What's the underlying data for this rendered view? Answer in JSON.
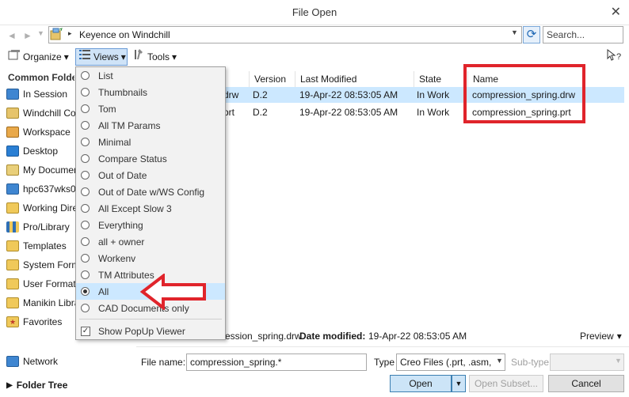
{
  "window": {
    "title": "File Open",
    "close_glyph": "✕"
  },
  "nav": {
    "back_glyph": "◄",
    "forward_glyph": "►"
  },
  "address": {
    "path": "Keyence on Windchill",
    "chevron": "▸",
    "dropdown_glyph": "▼",
    "refresh_glyph": "⟳",
    "search_placeholder": "Search..."
  },
  "toolbar": {
    "organize": "Organize",
    "views": "Views",
    "tools": "Tools",
    "caret": "▾",
    "help_glyph": "?"
  },
  "sidebar": {
    "header": "Common Folders",
    "items": [
      {
        "label": "In Session",
        "icon": "monitor-icon"
      },
      {
        "label": "Windchill Content",
        "icon": "windchill-icon"
      },
      {
        "label": "Workspace",
        "icon": "workspace-icon"
      },
      {
        "label": "Desktop",
        "icon": "desktop-icon"
      },
      {
        "label": "My Documents",
        "icon": "documents-icon"
      },
      {
        "label": "hpc637wks0",
        "icon": "computer-icon"
      },
      {
        "label": "Working Directory",
        "icon": "folder-icon"
      },
      {
        "label": "Pro/Library",
        "icon": "library-icon"
      },
      {
        "label": "Templates",
        "icon": "folder-icon"
      },
      {
        "label": "System Formats",
        "icon": "folder-icon"
      },
      {
        "label": "User Formats",
        "icon": "folder-icon"
      },
      {
        "label": "Manikin Library",
        "icon": "folder-icon"
      },
      {
        "label": "Favorites",
        "icon": "star-folder-icon"
      }
    ],
    "network": "Network",
    "folder_tree": "Folder Tree"
  },
  "table": {
    "headers": {
      "version": "Version",
      "last_modified": "Last Modified",
      "state": "State",
      "name": "Name"
    },
    "rows": [
      {
        "ext_frag": "drw",
        "version": "D.2",
        "last_modified": "19-Apr-22 08:53:05 AM",
        "state": "In Work",
        "name": "compression_spring.drw"
      },
      {
        "ext_frag": "prt",
        "version": "D.2",
        "last_modified": "19-Apr-22 08:53:05 AM",
        "state": "In Work",
        "name": "compression_spring.prt"
      }
    ]
  },
  "preview": {
    "file_frag": "ression_spring.drw",
    "modified_label": "Date modified:",
    "modified_value": "19-Apr-22 08:53:05 AM",
    "toggle": "Preview",
    "caret": "▾"
  },
  "bottom": {
    "file_name_label": "File name:",
    "file_name_value": "compression_spring.*",
    "type_label": "Type",
    "type_value": "Creo Files (.prt, .asm,",
    "subtype_label": "Sub-type",
    "open": "Open",
    "open_subset": "Open Subset...",
    "cancel": "Cancel"
  },
  "views_menu": {
    "items": [
      "List",
      "Thumbnails",
      "Tom",
      "All TM Params",
      "Minimal",
      "Compare Status",
      "Out of Date",
      "Out of Date w/WS Config",
      "All Except Slow 3",
      "Everything",
      "all + owner",
      "Workenv",
      "TM Attributes",
      "All",
      "CAD Documents only"
    ],
    "selected": "All",
    "check_item": "Show PopUp Viewer",
    "check_glyph": "✓"
  },
  "colors": {
    "highlight": "#cce8ff",
    "annotation": "#e0242b",
    "primary_button": "#cce4f7"
  }
}
